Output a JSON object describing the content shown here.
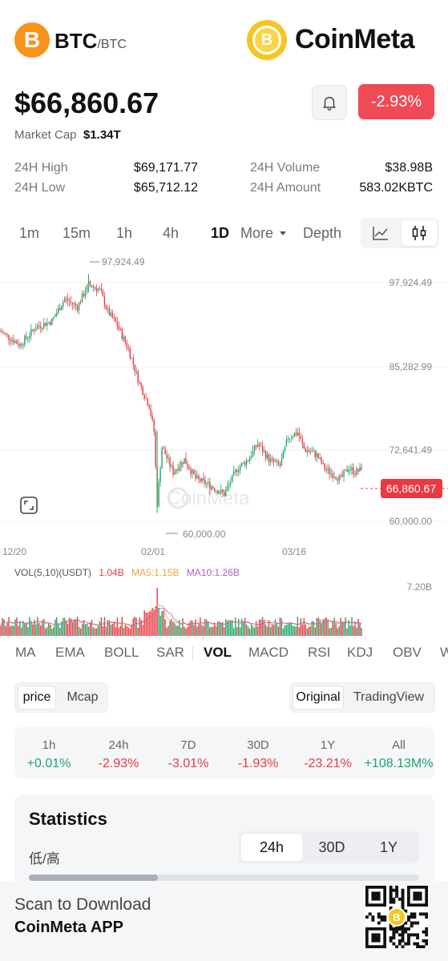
{
  "header": {
    "coin_symbol": "BTC",
    "pair_suffix": "/BTC",
    "coin_icon_glyph": "B",
    "brand_name": "CoinMeta",
    "brand_icon_glyph": "B"
  },
  "quote": {
    "price": "$66,860.67",
    "market_cap_label": "Market Cap",
    "market_cap_value": "$1.34T",
    "change_badge": "-2.93%",
    "bell_icon": "bell-icon"
  },
  "stats_24h": [
    {
      "label": "24H High",
      "value": "$69,171.77"
    },
    {
      "label": "24H Volume",
      "value": "$38.98B"
    },
    {
      "label": "24H Low",
      "value": "$65,712.12"
    },
    {
      "label": "24H Amount",
      "value": "583.02KBTC"
    }
  ],
  "timeframes": [
    "1m",
    "15m",
    "1h",
    "4h",
    "1D",
    "More",
    "Depth"
  ],
  "active_timeframe": "1D",
  "chart_data": {
    "type": "candlestick",
    "y_ticks": [
      "97,924.49",
      "85,282.99",
      "72,641.49",
      "60,000.00"
    ],
    "x_ticks": [
      "12/20",
      "02/01",
      "03/16"
    ],
    "high_marker": "97,924.49",
    "low_marker": "60,000.00",
    "current_price_label": "66,860.67",
    "ylim": [
      56000,
      100500
    ],
    "watermark": "CoinMeta",
    "close_path": [
      [
        0,
        88800
      ],
      [
        12,
        86700
      ],
      [
        22,
        89500
      ],
      [
        32,
        90500
      ],
      [
        40,
        94000
      ],
      [
        48,
        92700
      ],
      [
        55,
        96300
      ],
      [
        62,
        95400
      ],
      [
        67,
        92000
      ],
      [
        73,
        89800
      ],
      [
        80,
        86000
      ],
      [
        87,
        80500
      ],
      [
        93,
        77000
      ],
      [
        96,
        73000
      ],
      [
        98,
        61500
      ],
      [
        101,
        70500
      ],
      [
        108,
        66500
      ],
      [
        115,
        68500
      ],
      [
        122,
        65500
      ],
      [
        130,
        64500
      ],
      [
        140,
        63000
      ],
      [
        148,
        67000
      ],
      [
        155,
        68500
      ],
      [
        161,
        71000
      ],
      [
        168,
        68500
      ],
      [
        175,
        67500
      ],
      [
        180,
        72000
      ],
      [
        186,
        72800
      ],
      [
        190,
        70200
      ],
      [
        198,
        69200
      ],
      [
        203,
        67000
      ],
      [
        208,
        66200
      ],
      [
        213,
        65400
      ],
      [
        218,
        67200
      ],
      [
        222,
        66500
      ],
      [
        226,
        66860
      ]
    ],
    "volume": {
      "label": "VOL(5,10)(USDT)",
      "vol": "1.04B",
      "ma5": "MA5:1.15B",
      "ma10": "MA10:1.26B",
      "max_tick": "7.20B"
    },
    "up_color": "#1aa765",
    "down_color": "#ea3943",
    "ma5_color": "#e8a33c",
    "ma10_color": "#b15ec8"
  },
  "indicators": [
    "MA",
    "EMA",
    "BOLL",
    "SAR",
    "VOL",
    "MACD",
    "RSI",
    "KDJ",
    "OBV",
    "W"
  ],
  "active_indicator": "VOL",
  "view_mode": {
    "options": [
      "price",
      "Mcap"
    ],
    "selected": "price"
  },
  "chart_source": {
    "options": [
      "Original",
      "TradingView"
    ],
    "selected": "Original"
  },
  "performance": [
    {
      "label": "1h",
      "value": "+0.01%",
      "dir": "up"
    },
    {
      "label": "24h",
      "value": "-2.93%",
      "dir": "down"
    },
    {
      "label": "7D",
      "value": "-3.01%",
      "dir": "down"
    },
    {
      "label": "30D",
      "value": "-1.93%",
      "dir": "down"
    },
    {
      "label": "1Y",
      "value": "-23.21%",
      "dir": "down"
    },
    {
      "label": "All",
      "value": "+108.13M%",
      "dir": "up"
    }
  ],
  "statistics": {
    "title": "Statistics",
    "low_high_label": "低/高",
    "ranges": [
      "24h",
      "30D",
      "1Y"
    ],
    "selected_range": "24h",
    "range_progress": 0.33
  },
  "footer": {
    "line1": "Scan to Download",
    "line2": "CoinMeta APP",
    "qr_center_glyph": "B"
  },
  "icons": {
    "line_chart": "line-chart-icon",
    "candle_chart": "candlestick-chart-icon",
    "expand": "expand-icon",
    "dropdown": "caret-down-icon"
  }
}
